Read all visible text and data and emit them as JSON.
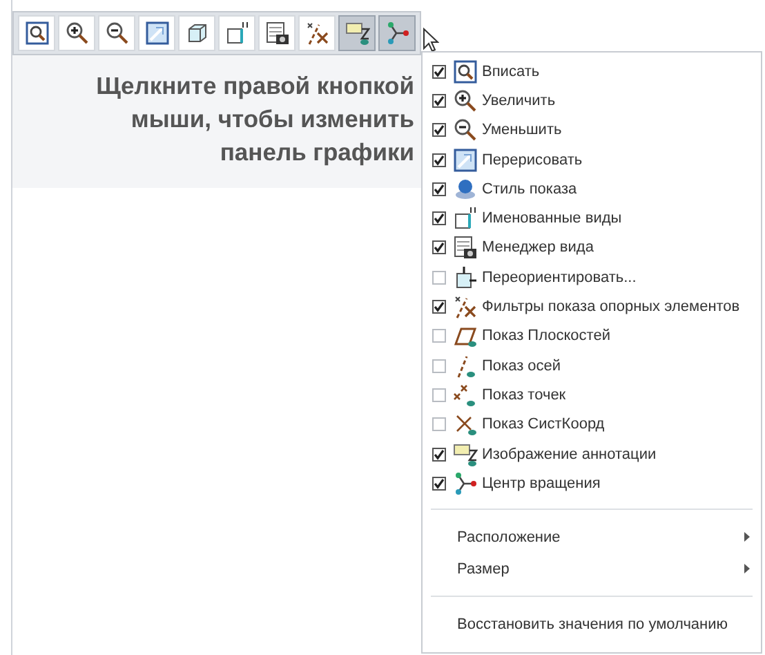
{
  "toolbar": {
    "buttons": [
      {
        "kind": "fit",
        "pressed": false
      },
      {
        "kind": "zoom-in",
        "pressed": false
      },
      {
        "kind": "zoom-out",
        "pressed": false
      },
      {
        "kind": "redraw",
        "pressed": false
      },
      {
        "kind": "cube",
        "pressed": false
      },
      {
        "kind": "named-views",
        "pressed": false
      },
      {
        "kind": "view-manager",
        "pressed": false
      },
      {
        "kind": "datum-filter",
        "pressed": false
      },
      {
        "kind": "annotation",
        "pressed": true
      },
      {
        "kind": "rotation-center",
        "pressed": true
      }
    ]
  },
  "hint": "Щелкните правой кнопкой мыши, чтобы изменить панель графики",
  "context_menu": {
    "items": [
      {
        "kind": "fit",
        "label": "Вписать",
        "checked": true
      },
      {
        "kind": "zoom-in",
        "label": "Увеличить",
        "checked": true
      },
      {
        "kind": "zoom-out",
        "label": "Уменьшить",
        "checked": true
      },
      {
        "kind": "redraw",
        "label": "Перерисовать",
        "checked": true
      },
      {
        "kind": "display-style",
        "label": "Стиль показа",
        "checked": true
      },
      {
        "kind": "named-views",
        "label": "Именованные виды",
        "checked": true
      },
      {
        "kind": "view-manager",
        "label": "Менеджер вида",
        "checked": true
      },
      {
        "kind": "reorient",
        "label": "Переориентировать...",
        "checked": false
      },
      {
        "kind": "datum-filter",
        "label": "Фильтры показа опорных элементов",
        "checked": true
      },
      {
        "kind": "planes",
        "label": "Показ Плоскостей",
        "checked": false
      },
      {
        "kind": "axes",
        "label": "Показ осей",
        "checked": false
      },
      {
        "kind": "points",
        "label": "Показ точек",
        "checked": false
      },
      {
        "kind": "csys",
        "label": "Показ СистКоорд",
        "checked": false
      },
      {
        "kind": "annotation",
        "label": "Изображение аннотации",
        "checked": true
      },
      {
        "kind": "rotation-center",
        "label": "Центр вращения",
        "checked": true
      }
    ],
    "submenus": [
      "Расположение",
      "Размер"
    ],
    "reset": "Восстановить значения по умолчанию"
  }
}
